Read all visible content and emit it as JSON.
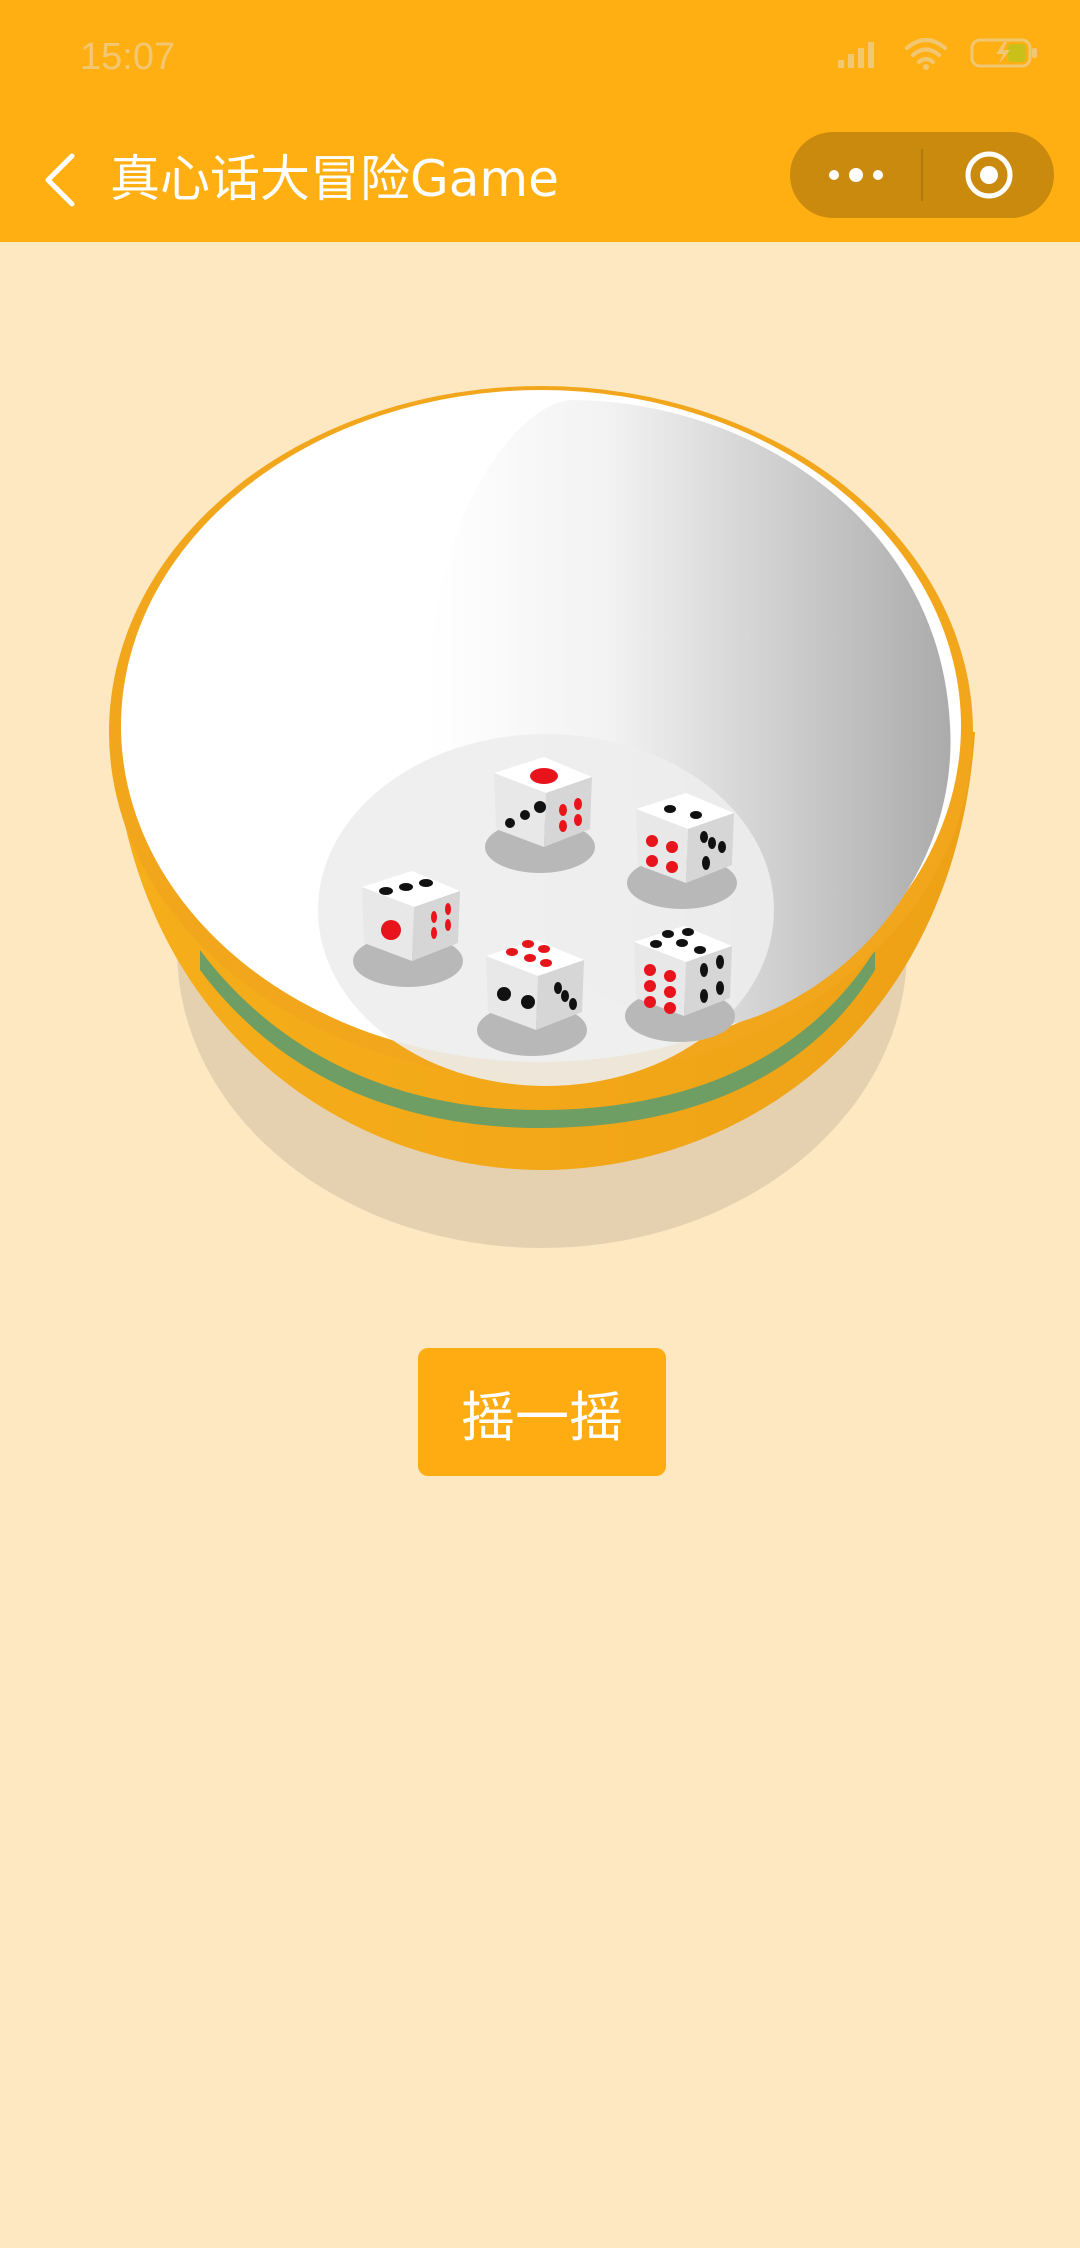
{
  "status_bar": {
    "time": "15:07",
    "icons": [
      "signal-icon",
      "wifi-icon",
      "battery-charging-icon"
    ]
  },
  "nav": {
    "back_icon": "chevron-left-icon",
    "title": "真心话大冒险Game",
    "more_icon": "more-dots-icon",
    "close_icon": "target-circle-icon"
  },
  "game": {
    "dice_count": 5,
    "shake_button_label": "摇一摇"
  },
  "colors": {
    "theme": "#FFAF12",
    "background": "#FEE8C2",
    "capsule": "#C98A0E",
    "bowl": "#F4A818",
    "pip_red": "#E8141C",
    "pip_black": "#111111"
  }
}
